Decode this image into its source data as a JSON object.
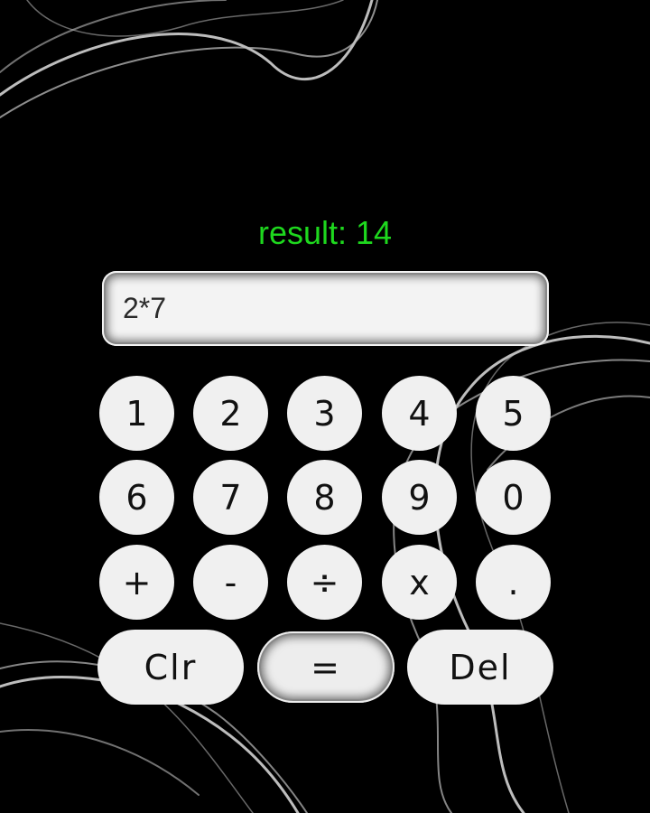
{
  "result_text": "result: 14",
  "expression": "2*7",
  "colors": {
    "background": "#000000",
    "result": "#1ed81e",
    "key": "#f0f0f0",
    "key_text": "#111111"
  },
  "keys": {
    "k1": "1",
    "k2": "2",
    "k3": "3",
    "k4": "4",
    "k5": "5",
    "k6": "6",
    "k7": "7",
    "k8": "8",
    "k9": "9",
    "k0": "0",
    "plus": "+",
    "minus": "-",
    "divide": "÷",
    "multiply": "x",
    "dot": "."
  },
  "actions": {
    "clear": "Clr",
    "equals": "=",
    "delete": "Del"
  }
}
